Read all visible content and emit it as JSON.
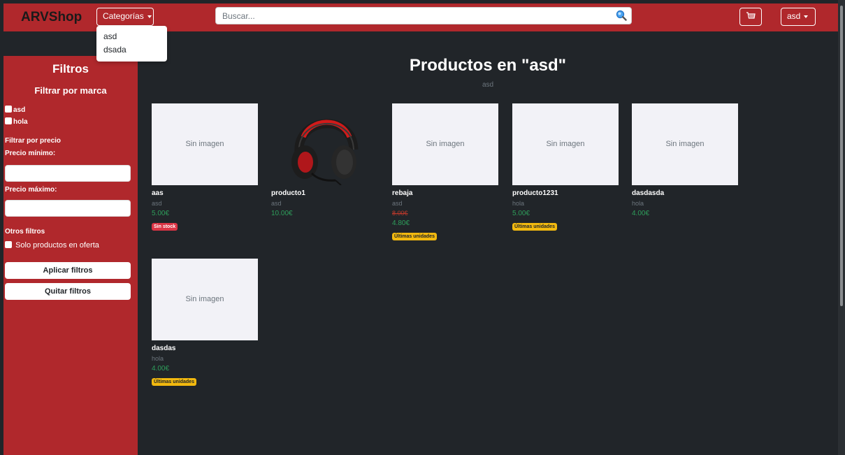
{
  "navbar": {
    "brand": "ARVShop",
    "categories_label": "Categorías",
    "search_placeholder": "Buscar...",
    "user_label": "asd"
  },
  "categories_dropdown": [
    "asd",
    "dsada"
  ],
  "sidebar": {
    "title": "Filtros",
    "brand_filter_title": "Filtrar por marca",
    "brands": [
      "asd",
      "hola"
    ],
    "price_filter_title": "Filtrar por precio",
    "min_label": "Precio mínimo:",
    "max_label": "Precio máximo:",
    "other_title": "Otros filtros",
    "offer_label": "Solo productos en oferta",
    "apply_label": "Aplicar filtros",
    "clear_label": "Quitar filtros"
  },
  "main": {
    "title": "Productos en \"asd\"",
    "subtitle": "asd",
    "no_image": "Sin imagen"
  },
  "products": [
    {
      "name": "aas",
      "brand": "asd",
      "price": "5.00€",
      "badge": "Sin stock"
    },
    {
      "name": "producto1",
      "brand": "asd",
      "price": "10.00€"
    },
    {
      "name": "rebaja",
      "brand": "asd",
      "old_price": "8.00€",
      "price": "4.80€",
      "badge": "Últimas unidades"
    },
    {
      "name": "producto1231",
      "brand": "hola",
      "price": "5.00€",
      "badge": "Últimas unidades"
    },
    {
      "name": "dasdasda",
      "brand": "hola",
      "price": "4.00€"
    },
    {
      "name": "dasdas",
      "brand": "hola",
      "price": "4.00€",
      "badge": "Últimas unidades"
    }
  ],
  "colors": {
    "accent": "#b0282c",
    "background": "#212529",
    "price": "#2e9e5b",
    "badge_red": "#dc3545",
    "badge_yellow": "#f2b90f"
  },
  "icons": {
    "search": "search-icon",
    "cart": "cart-icon"
  }
}
